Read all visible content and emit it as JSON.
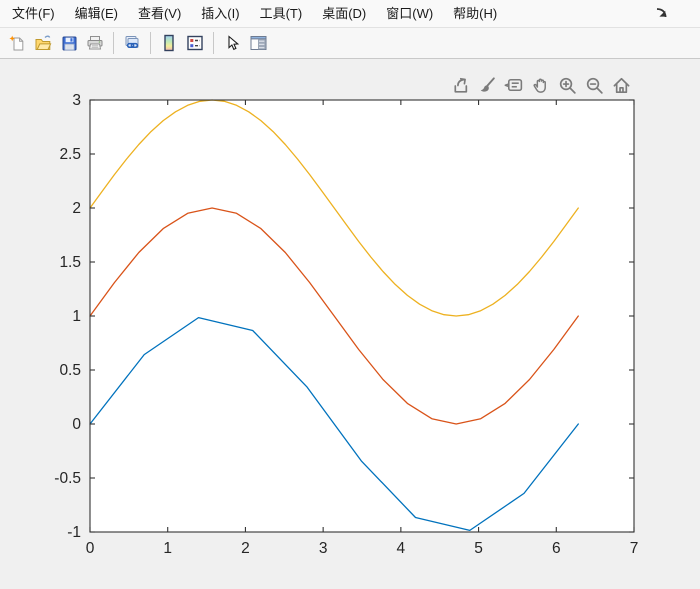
{
  "colors": {
    "window_bg": "#f0f0f0",
    "plot_bg": "#ffffff",
    "axis_color": "#333333",
    "tick_label_color": "#262626",
    "blue_line": "#0072BD",
    "orange_line": "#D95319",
    "yellow_line": "#EDB120"
  },
  "menu_bar": {
    "items": [
      {
        "label": "文件(F)"
      },
      {
        "label": "编辑(E)"
      },
      {
        "label": "查看(V)"
      },
      {
        "label": "插入(I)"
      },
      {
        "label": "工具(T)"
      },
      {
        "label": "桌面(D)"
      },
      {
        "label": "窗口(W)"
      },
      {
        "label": "帮助(H)"
      }
    ],
    "dock_arrow_icon": "dock-arrow-icon"
  },
  "toolbar": {
    "icons": [
      "new-figure-icon",
      "open-file-icon",
      "save-figure-icon",
      "print-figure-icon",
      "link-plot-icon",
      "insert-colorbar-icon",
      "insert-legend-icon",
      "edit-plot-icon",
      "property-inspector-icon"
    ]
  },
  "axes_toolbar": {
    "icons": [
      "export-icon",
      "brush-icon",
      "datatips-icon",
      "pan-icon",
      "zoom-in-icon",
      "zoom-out-icon",
      "restore-view-icon"
    ]
  },
  "chart_data": {
    "type": "line",
    "title": "",
    "xlabel": "",
    "ylabel": "",
    "xlim": [
      0,
      7
    ],
    "ylim": [
      -1,
      3
    ],
    "xticks": [
      0,
      1,
      2,
      3,
      4,
      5,
      6,
      7
    ],
    "yticks": [
      -1,
      -0.5,
      0,
      0.5,
      1,
      1.5,
      2,
      2.5,
      3
    ],
    "xtick_labels": [
      "0",
      "1",
      "2",
      "3",
      "4",
      "5",
      "6",
      "7"
    ],
    "ytick_labels": [
      "-1",
      "-0.5",
      "0",
      "0.5",
      "1",
      "1.5",
      "2",
      "2.5",
      "3"
    ],
    "grid": false,
    "box": true,
    "tick_dir": "in",
    "legend": null,
    "series": [
      {
        "name": "series1-blue-sin",
        "color": "#0072BD",
        "x": [
          0,
          0.698,
          1.396,
          2.094,
          2.793,
          3.491,
          4.189,
          4.887,
          5.585,
          6.283
        ],
        "y": [
          0,
          0.643,
          0.985,
          0.866,
          0.342,
          -0.342,
          -0.866,
          -0.985,
          -0.643,
          0
        ]
      },
      {
        "name": "series2-orange-sin-plus-1",
        "color": "#D95319",
        "x": [
          0,
          0.314,
          0.628,
          0.942,
          1.257,
          1.571,
          1.885,
          2.199,
          2.513,
          2.827,
          3.142,
          3.456,
          3.77,
          4.084,
          4.398,
          4.712,
          5.027,
          5.341,
          5.655,
          5.969,
          6.283
        ],
        "y": [
          1,
          1.309,
          1.588,
          1.809,
          1.951,
          2,
          1.951,
          1.809,
          1.588,
          1.309,
          1,
          0.691,
          0.412,
          0.191,
          0.049,
          0,
          0.049,
          0.191,
          0.412,
          0.691,
          1
        ]
      },
      {
        "name": "series3-yellow-sin-plus-2",
        "color": "#EDB120",
        "x": [
          0,
          0.157,
          0.314,
          0.471,
          0.628,
          0.785,
          0.942,
          1.1,
          1.257,
          1.414,
          1.571,
          1.728,
          1.885,
          2.042,
          2.199,
          2.356,
          2.513,
          2.67,
          2.827,
          2.985,
          3.142,
          3.299,
          3.456,
          3.613,
          3.77,
          3.927,
          4.084,
          4.241,
          4.398,
          4.555,
          4.712,
          4.869,
          5.027,
          5.184,
          5.341,
          5.498,
          5.655,
          5.812,
          5.969,
          6.126,
          6.283
        ],
        "y": [
          2,
          2.156,
          2.309,
          2.454,
          2.588,
          2.707,
          2.809,
          2.891,
          2.951,
          2.988,
          3,
          2.988,
          2.951,
          2.891,
          2.809,
          2.707,
          2.588,
          2.454,
          2.309,
          2.156,
          2,
          1.844,
          1.691,
          1.546,
          1.412,
          1.293,
          1.191,
          1.109,
          1.049,
          1.012,
          1,
          1.012,
          1.049,
          1.109,
          1.191,
          1.293,
          1.412,
          1.546,
          1.691,
          1.844,
          2
        ]
      }
    ]
  }
}
